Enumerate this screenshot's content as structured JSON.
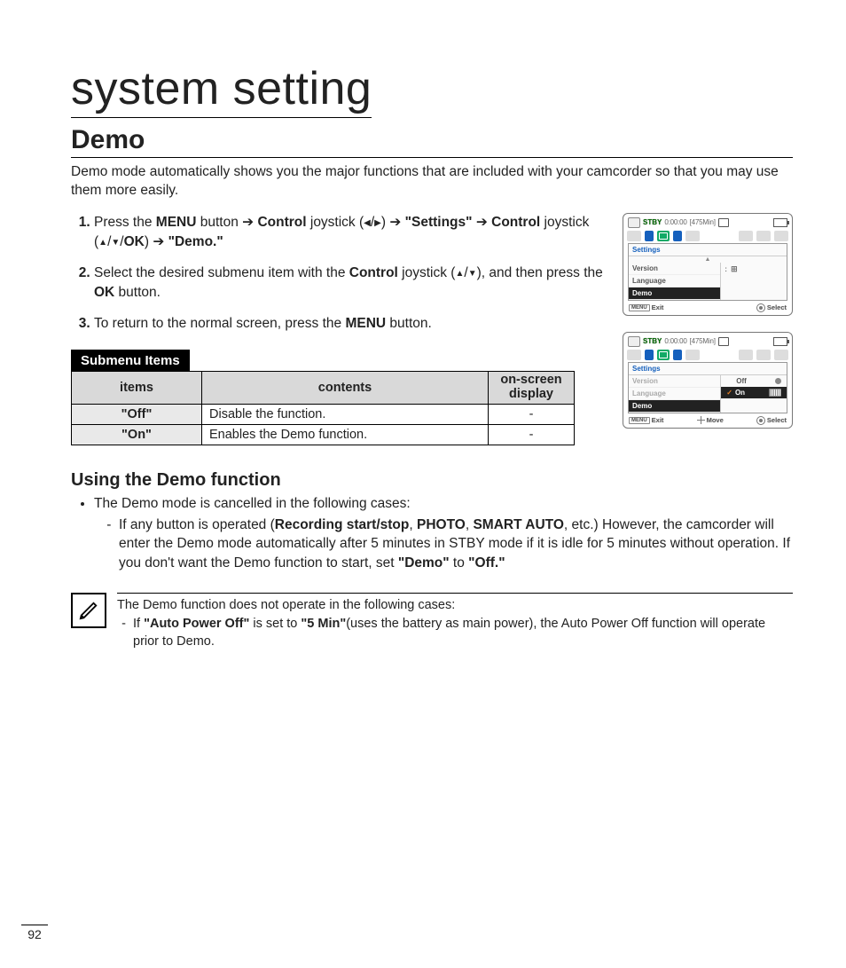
{
  "title": "system setting",
  "heading": "Demo",
  "intro": "Demo mode automatically shows you the major functions that are included with your camcorder so that you may use them more easily.",
  "steps": {
    "s1a": "Press the ",
    "s1_menu": "MENU",
    "s1b": " button ",
    "arrow": "➔",
    "s1_control": "Control",
    "s1c": " joystick (",
    "tri_l": "◀",
    "tri_r": "▶",
    "s1d": ") ",
    "s1_settings": "\"Settings\"",
    "s1e": " ",
    "s1f": " joystick (",
    "tri_u": "▲",
    "tri_d": "▼",
    "ok": "OK",
    "s1g": ") ",
    "s1_demo": "\"Demo.\"",
    "s2a": "Select the desired submenu item with the ",
    "s2b": " joystick (",
    "s2c": "), and then press the ",
    "s2d": " button.",
    "s3a": "To return to the normal screen, press the ",
    "s3b": " button."
  },
  "screen": {
    "stby": "STBY",
    "time": "0:00:00",
    "remain": "[475Min]",
    "settings": "Settings",
    "version": "Version",
    "language": "Language",
    "demo": "Demo",
    "off": "Off",
    "on": "On",
    "menu": "MENU",
    "exit": "Exit",
    "move": "Move",
    "select": "Select"
  },
  "submenu": {
    "label": "Submenu Items",
    "h_items": "items",
    "h_contents": "contents",
    "h_osd": "on-screen display",
    "r1_item": "\"Off\"",
    "r1_cont": "Disable the function.",
    "r1_osd": "-",
    "r2_item": "\"On\"",
    "r2_cont": "Enables the Demo function.",
    "r2_osd": "-"
  },
  "using": {
    "title": "Using the Demo function",
    "b1": "The Demo mode is cancelled in the following cases:",
    "b1s_a": "If any button is operated (",
    "rec": "Recording start/stop",
    "comma": ", ",
    "photo": "PHOTO",
    "smart": "SMART AUTO",
    "b1s_b": ", etc.) However, the camcorder will enter the Demo mode automatically after 5 minutes in STBY mode if it is idle for 5 minutes without operation. If you don't want the Demo function to start, set ",
    "demoq": "\"Demo\"",
    "to": " to ",
    "offq": "\"Off.\""
  },
  "note": {
    "lead": "The Demo function does not operate in the following cases:",
    "s_a": "If ",
    "apo": "\"Auto Power Off\"",
    "s_b": " is set to ",
    "fivemin": "\"5 Min\"",
    "s_c": "(uses the battery as main power), the Auto Power Off function will operate prior to Demo."
  },
  "pagenum": "92"
}
